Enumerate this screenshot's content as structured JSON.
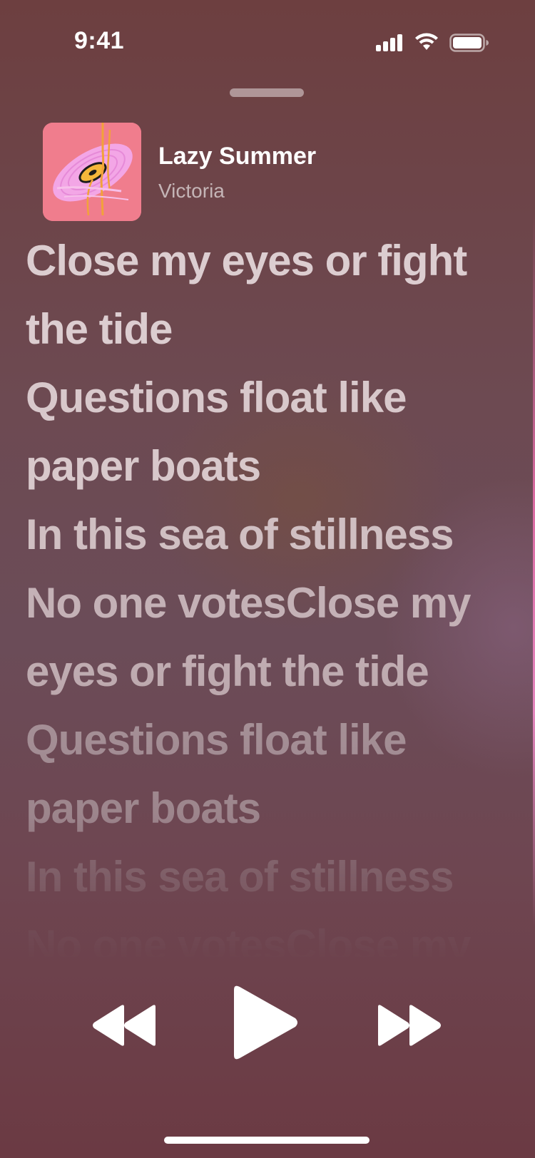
{
  "status_bar": {
    "time": "9:41",
    "icons": [
      "cellular-signal-icon",
      "wifi-icon",
      "battery-icon"
    ]
  },
  "now_playing": {
    "title": "Lazy Summer",
    "artist": "Victoria",
    "artwork": "vinyl-record-artwork"
  },
  "lyrics": {
    "lines": [
      "Close my eyes or fight the tide",
      "Questions float like paper boats",
      "In this sea of stillness",
      "No one votesClose my eyes or fight the tide",
      "Questions float like paper boats",
      "In this sea of stillness",
      "No one votesClose my"
    ]
  },
  "controls": {
    "rewind": "rewind-icon",
    "play": "play-icon",
    "forward": "fast-forward-icon"
  },
  "colors": {
    "background_top": "#6d3f40",
    "background_bottom": "#6b3a43",
    "lyric_text": "#dccdd0",
    "artwork_pink": "#f07d8d"
  }
}
